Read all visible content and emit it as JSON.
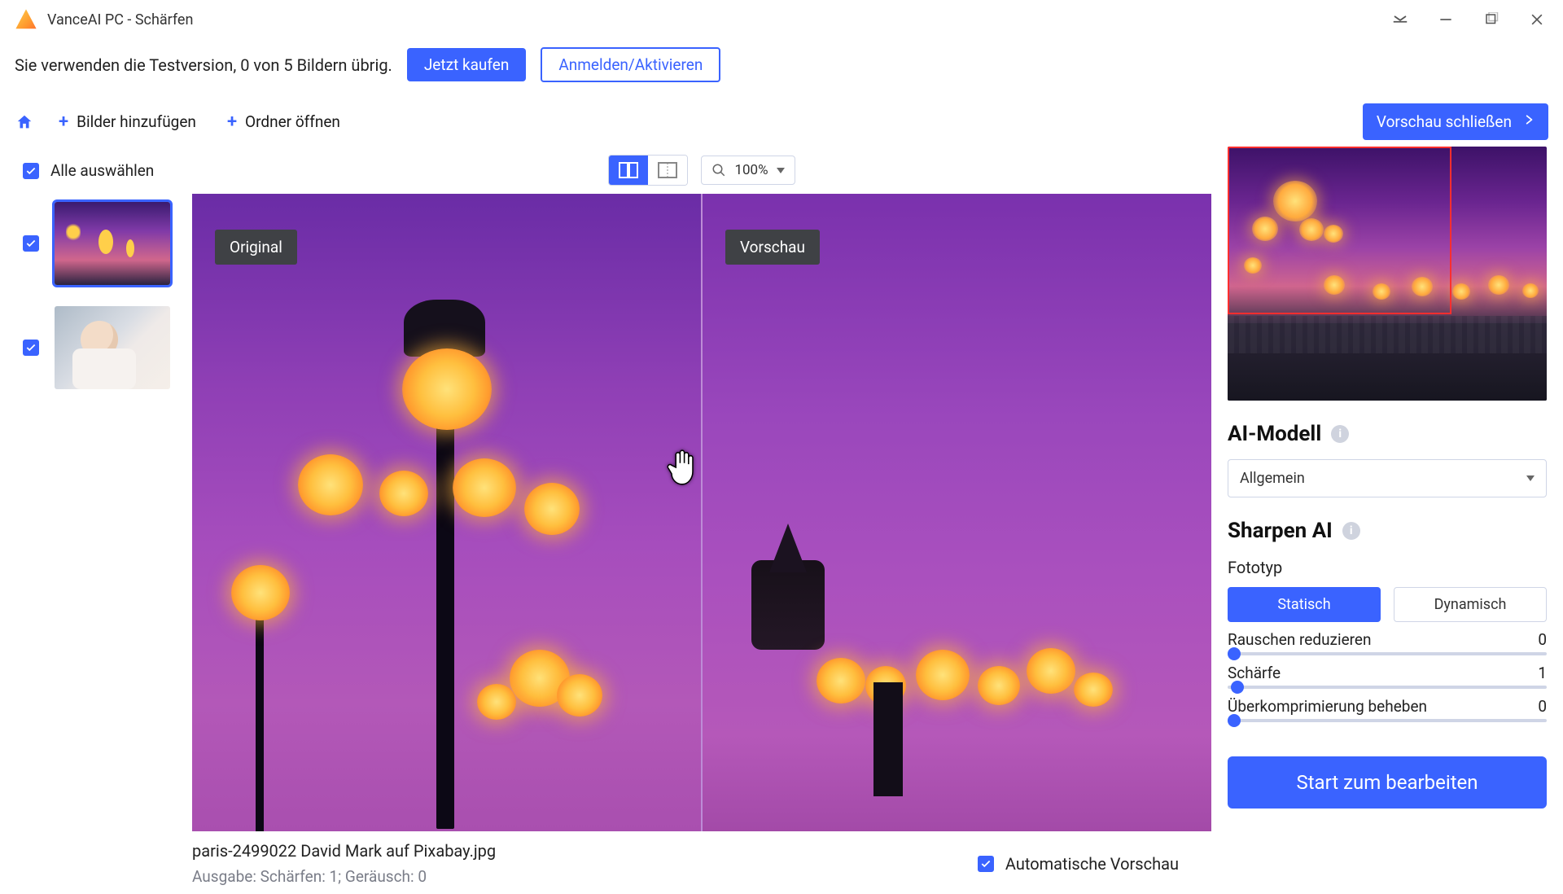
{
  "title_bar": {
    "app_title": "VanceAI PC - Schärfen"
  },
  "trial": {
    "text": "Sie verwenden die Testversion, 0 von 5 Bildern übrig.",
    "buy_label": "Jetzt kaufen",
    "login_label": "Anmelden/Aktivieren"
  },
  "toolbar": {
    "add_images_label": "Bilder hinzufügen",
    "open_folder_label": "Ordner öffnen",
    "close_preview_label": "Vorschau schließen"
  },
  "sidebar": {
    "select_all_label": "Alle auswählen"
  },
  "viewer": {
    "original_label": "Original",
    "preview_label": "Vorschau",
    "zoom_label": "100%"
  },
  "status": {
    "filename": "paris-2499022  David Mark auf Pixabay.jpg",
    "output_line": "Ausgabe: Schärfen: 1; Geräusch: 0",
    "auto_preview_label": "Automatische Vorschau"
  },
  "panel": {
    "ai_model_title": "AI-Modell",
    "ai_model_value": "Allgemein",
    "sharpen_title": "Sharpen AI",
    "phototype_label": "Fototyp",
    "static_label": "Statisch",
    "dynamic_label": "Dynamisch",
    "noise_label": "Rauschen reduzieren",
    "noise_value": "0",
    "sharp_label": "Schärfe",
    "sharp_value": "1",
    "overcomp_label": "Überkomprimierung beheben",
    "overcomp_value": "0",
    "start_label": "Start zum bearbeiten"
  }
}
